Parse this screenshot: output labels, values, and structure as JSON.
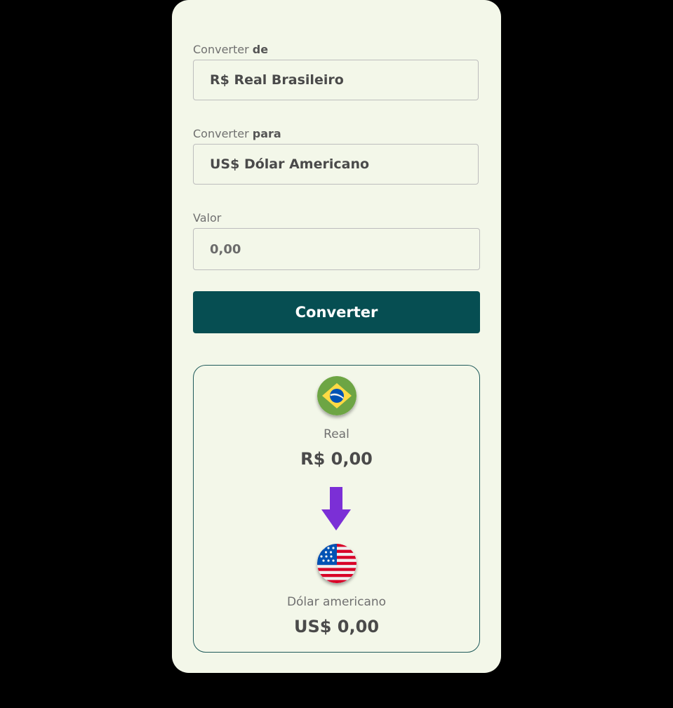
{
  "form": {
    "from_label_prefix": "Converter",
    "from_label_bold": "de",
    "from_selected": "R$ Real Brasileiro",
    "to_label_prefix": "Converter",
    "to_label_bold": "para",
    "to_selected": "US$ Dólar Americano",
    "value_label": "Valor",
    "value_placeholder": "0,00",
    "convert_label": "Converter"
  },
  "result": {
    "from_name": "Real",
    "from_value": "R$ 0,00",
    "to_name": "Dólar americano",
    "to_value": "US$ 0,00"
  },
  "icons": {
    "from_flag": "brazil-flag-icon",
    "arrow": "arrow-down-icon",
    "to_flag": "usa-flag-icon"
  },
  "colors": {
    "card_bg": "#f3f7e9",
    "button_bg": "#064e52",
    "arrow": "#7b2fd6"
  }
}
